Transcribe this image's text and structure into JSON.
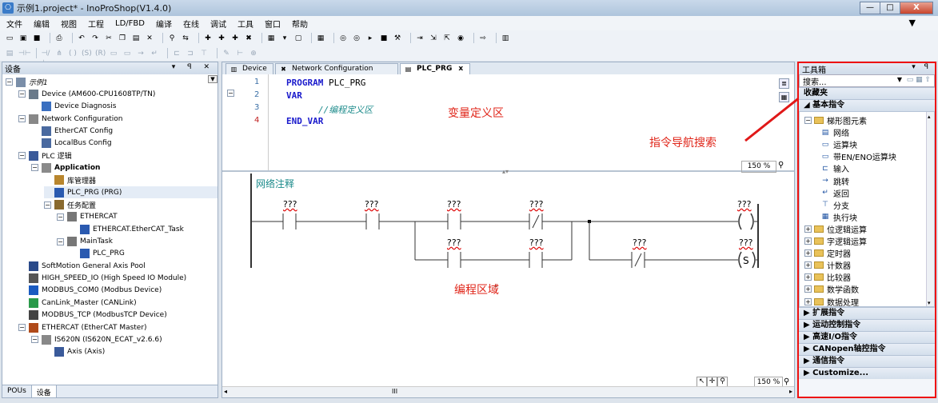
{
  "window": {
    "title": "示例1.project* - InoProShop(V1.4.0)",
    "btn_min": "—",
    "btn_max": "□",
    "btn_close": "X"
  },
  "menu": [
    "文件",
    "编辑",
    "视图",
    "工程",
    "LD/FBD",
    "编译",
    "在线",
    "调试",
    "工具",
    "窗口",
    "帮助"
  ],
  "left_panel": {
    "title": "设备",
    "tabs": [
      "POUs",
      "设备"
    ],
    "tree": [
      {
        "label": "示例1",
        "indent": 0,
        "exp": "−",
        "icon": "project-icon",
        "italic": true
      },
      {
        "label": "Device (AM600-CPU1608TP/TN)",
        "indent": 1,
        "exp": "−",
        "icon": "device-icon"
      },
      {
        "label": "Device Diagnosis",
        "indent": 2,
        "exp": "",
        "icon": "diagnosis-icon"
      },
      {
        "label": "Network Configuration",
        "indent": 1,
        "exp": "−",
        "icon": "network-icon"
      },
      {
        "label": "EtherCAT Config",
        "indent": 2,
        "exp": "",
        "icon": "config-icon"
      },
      {
        "label": "LocalBus Config",
        "indent": 2,
        "exp": "",
        "icon": "config-icon"
      },
      {
        "label": "PLC 逻辑",
        "indent": 1,
        "exp": "−",
        "icon": "plc-icon"
      },
      {
        "label": "Application",
        "indent": 2,
        "exp": "−",
        "icon": "application-icon",
        "bold": true
      },
      {
        "label": "库管理器",
        "indent": 3,
        "exp": "",
        "icon": "library-icon"
      },
      {
        "label": "PLC_PRG (PRG)",
        "indent": 3,
        "exp": "",
        "icon": "prg-icon",
        "selected": true
      },
      {
        "label": "任务配置",
        "indent": 3,
        "exp": "−",
        "icon": "task-icon"
      },
      {
        "label": "ETHERCAT",
        "indent": 4,
        "exp": "−",
        "icon": "gear-icon"
      },
      {
        "label": "ETHERCAT.EtherCAT_Task",
        "indent": 5,
        "exp": "",
        "icon": "prg-icon"
      },
      {
        "label": "MainTask",
        "indent": 4,
        "exp": "−",
        "icon": "gear-icon"
      },
      {
        "label": "PLC_PRG",
        "indent": 5,
        "exp": "",
        "icon": "prg-icon"
      },
      {
        "label": "SoftMotion General Axis Pool",
        "indent": 1,
        "exp": "",
        "icon": "axis-pool-icon"
      },
      {
        "label": "HIGH_SPEED_IO (High Speed IO Module)",
        "indent": 1,
        "exp": "",
        "icon": "io-icon"
      },
      {
        "label": "MODBUS_COM0 (Modbus Device)",
        "indent": 1,
        "exp": "",
        "icon": "modbus-icon"
      },
      {
        "label": "CanLink_Master (CANLink)",
        "indent": 1,
        "exp": "",
        "icon": "canlink-icon"
      },
      {
        "label": "MODBUS_TCP (ModbusTCP Device)",
        "indent": 1,
        "exp": "",
        "icon": "tcp-icon"
      },
      {
        "label": "ETHERCAT (EtherCAT Master)",
        "indent": 1,
        "exp": "−",
        "icon": "ethercat-icon"
      },
      {
        "label": "IS620N (IS620N_ECAT_v2.6.6)",
        "indent": 2,
        "exp": "−",
        "icon": "drive-icon"
      },
      {
        "label": "Axis (Axis)",
        "indent": 3,
        "exp": "",
        "icon": "axis-icon"
      }
    ]
  },
  "editor": {
    "tabs": [
      {
        "label": "Device",
        "active": false
      },
      {
        "label": "Network Configuration",
        "active": false
      },
      {
        "label": "PLC_PRG",
        "active": true,
        "close": "x"
      }
    ],
    "code": [
      {
        "n": "1",
        "text": "PROGRAM PLC_PRG",
        "kind": "program"
      },
      {
        "n": "2",
        "text": "VAR",
        "kind": "kw"
      },
      {
        "n": "3",
        "text": "//编程定义区",
        "kind": "comment"
      },
      {
        "n": "4",
        "text": "END_VAR",
        "kind": "kw"
      }
    ],
    "annotation_var": "变量定义区",
    "annotation_prog": "编程区域",
    "annotation_search": "指令导航搜索",
    "network_comment": "网络注释",
    "zoom_top": "150 %",
    "zoom_bottom": "150 %",
    "placeholder": "???",
    "scroll_thumb": "III"
  },
  "toolbox": {
    "title": "工具箱",
    "search_placeholder": "搜索...",
    "favorites": "收藏夹",
    "basic": "基本指令",
    "items": [
      {
        "label": "梯形图元素",
        "type": "folder",
        "exp": "−",
        "indent": 0
      },
      {
        "label": "网络",
        "type": "item",
        "indent": 1,
        "icon": "network-item-icon"
      },
      {
        "label": "运算块",
        "type": "item",
        "indent": 1,
        "icon": "block-icon"
      },
      {
        "label": "带EN/ENO运算块",
        "type": "item",
        "indent": 1,
        "icon": "en-block-icon"
      },
      {
        "label": "输入",
        "type": "item",
        "indent": 1,
        "icon": "input-icon"
      },
      {
        "label": "跳转",
        "type": "item",
        "indent": 1,
        "icon": "jump-icon"
      },
      {
        "label": "返回",
        "type": "item",
        "indent": 1,
        "icon": "return-icon"
      },
      {
        "label": "分支",
        "type": "item",
        "indent": 1,
        "icon": "branch-icon"
      },
      {
        "label": "执行块",
        "type": "item",
        "indent": 1,
        "icon": "exec-icon"
      },
      {
        "label": "位逻辑运算",
        "type": "folder",
        "exp": "+",
        "indent": 0
      },
      {
        "label": "字逻辑运算",
        "type": "folder",
        "exp": "+",
        "indent": 0
      },
      {
        "label": "定时器",
        "type": "folder",
        "exp": "+",
        "indent": 0
      },
      {
        "label": "计数器",
        "type": "folder",
        "exp": "+",
        "indent": 0
      },
      {
        "label": "比较器",
        "type": "folder",
        "exp": "+",
        "indent": 0
      },
      {
        "label": "数学函数",
        "type": "folder",
        "exp": "+",
        "indent": 0
      },
      {
        "label": "数据处理",
        "type": "folder",
        "exp": "+",
        "indent": 0
      }
    ],
    "groups": [
      "扩展指令",
      "运动控制指令",
      "高速I/O指令",
      "CANopen轴控指令",
      "通信指令",
      "Customize..."
    ]
  }
}
